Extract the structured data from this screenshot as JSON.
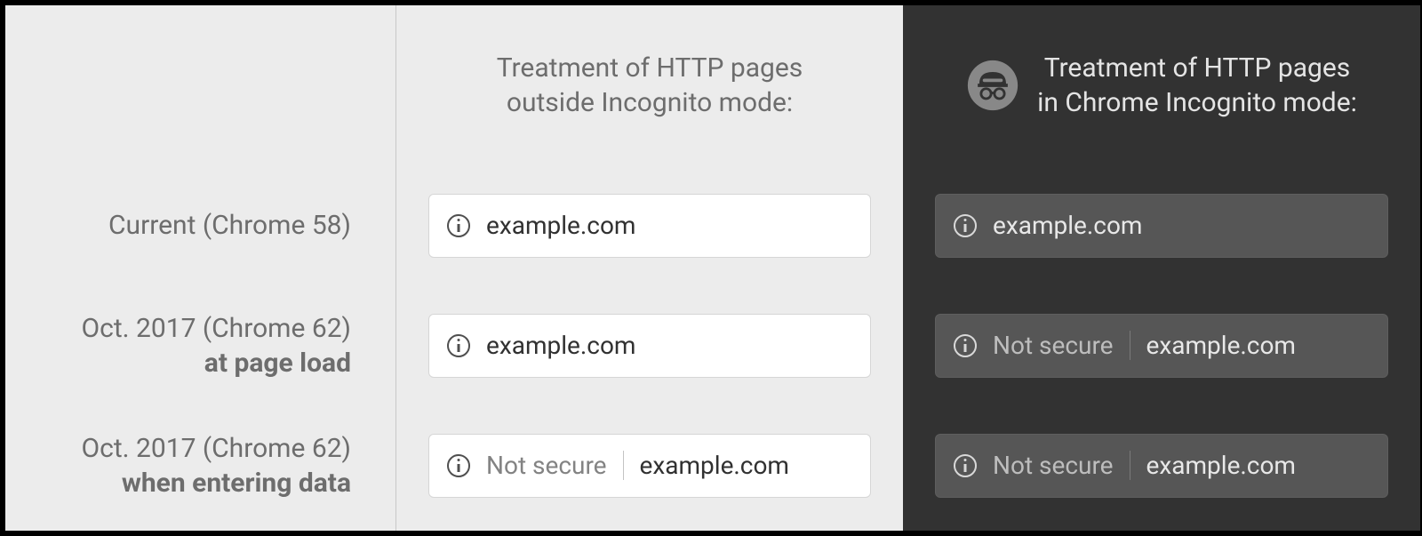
{
  "columns": {
    "normal_header_line1": "Treatment of HTTP pages",
    "normal_header_line2": "outside Incognito mode:",
    "incognito_header_line1": "Treatment of HTTP pages",
    "incognito_header_line2": "in Chrome Incognito mode:"
  },
  "rows": [
    {
      "label_main": "Current (Chrome 58)",
      "label_sub": "",
      "normal": {
        "not_secure": "",
        "url": "example.com"
      },
      "incognito": {
        "not_secure": "",
        "url": "example.com"
      }
    },
    {
      "label_main": "Oct. 2017 (Chrome 62)",
      "label_sub": "at page load",
      "normal": {
        "not_secure": "",
        "url": "example.com"
      },
      "incognito": {
        "not_secure": "Not secure",
        "url": "example.com"
      }
    },
    {
      "label_main": "Oct. 2017 (Chrome 62)",
      "label_sub": "when entering data",
      "normal": {
        "not_secure": "Not secure",
        "url": "example.com"
      },
      "incognito": {
        "not_secure": "Not secure",
        "url": "example.com"
      }
    }
  ]
}
